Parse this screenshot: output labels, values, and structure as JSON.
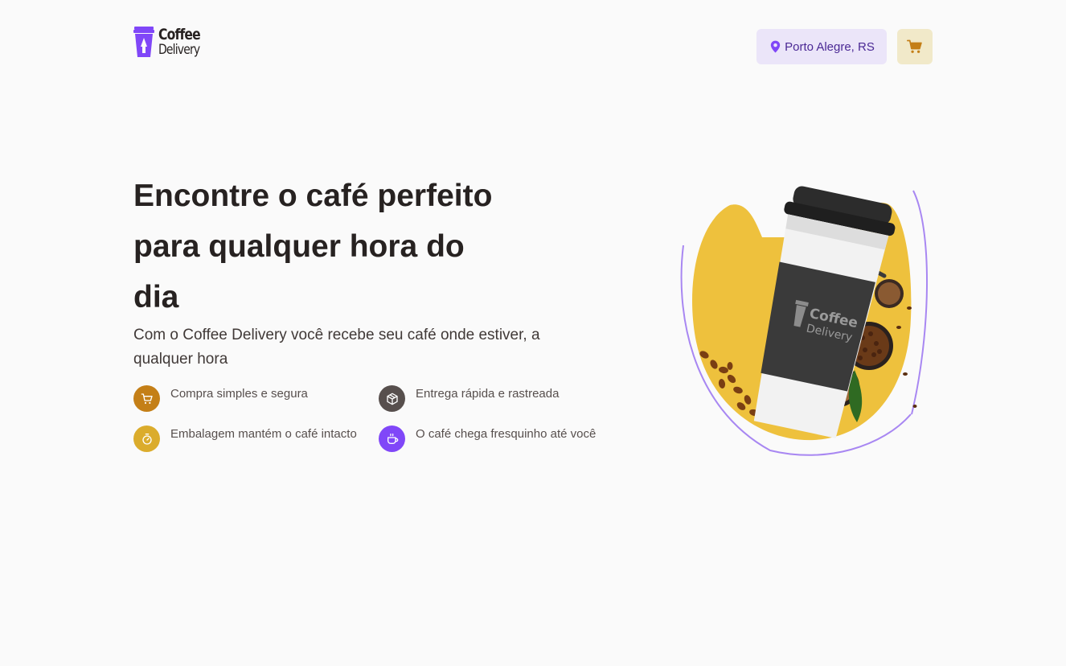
{
  "header": {
    "logo_line1": "Coffee",
    "logo_line2": "Delivery",
    "location": "Porto Alegre, RS",
    "icons": {
      "location": "map-pin-icon",
      "cart": "shopping-cart-icon"
    }
  },
  "hero": {
    "title": "Encontre o café perfeito para qualquer hora do dia",
    "subtitle": "Com o Coffee Delivery você recebe seu café onde estiver, a qualquer hora",
    "features": [
      {
        "label": "Compra simples e segura",
        "icon": "shopping-cart-icon",
        "color": "#C47F17"
      },
      {
        "label": "Entrega rápida e rastreada",
        "icon": "package-icon",
        "color": "#574F4D"
      },
      {
        "label": "Embalagem mantém o café intacto",
        "icon": "timer-icon",
        "color": "#DBAC2C"
      },
      {
        "label": "O café chega fresquinho até você",
        "icon": "coffee-icon",
        "color": "#8047F8"
      }
    ],
    "cup_logo_line1": "Coffee",
    "cup_logo_line2": "Delivery"
  },
  "colors": {
    "background": "#FAFAFA",
    "purple": "#8047F8",
    "purple_dark": "#4B2995",
    "purple_light": "#EBE5F9",
    "yellow": "#DBAC2C",
    "yellow_dark": "#C47F17",
    "yellow_light": "#F1E9C9",
    "title": "#272221"
  }
}
